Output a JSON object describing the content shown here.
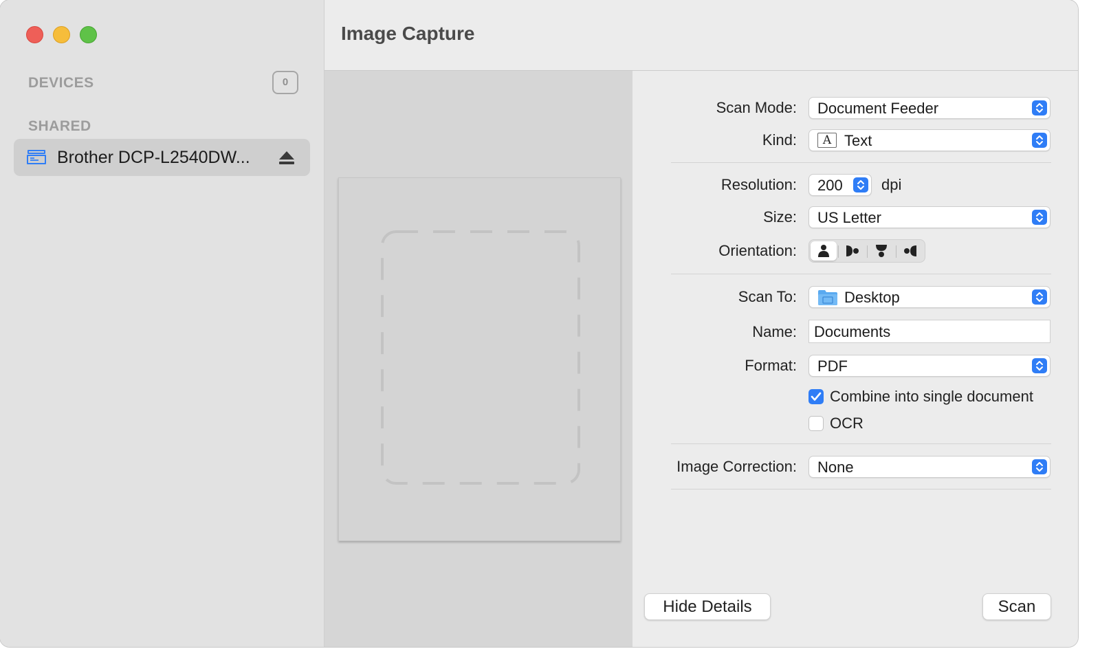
{
  "window": {
    "title": "Image Capture"
  },
  "sidebar": {
    "devices_label": "DEVICES",
    "devices_count": "0",
    "shared_label": "SHARED",
    "shared_items": [
      {
        "label": "Brother DCP-L2540DW...",
        "icon": "scanner-icon",
        "action_icon": "eject-icon"
      }
    ]
  },
  "scan_settings": {
    "scan_mode": {
      "label": "Scan Mode:",
      "value": "Document Feeder"
    },
    "kind": {
      "label": "Kind:",
      "value": "Text",
      "icon": "text-kind-icon",
      "icon_glyph": "A"
    },
    "resolution": {
      "label": "Resolution:",
      "value": "200",
      "unit": "dpi"
    },
    "size": {
      "label": "Size:",
      "value": "US Letter"
    },
    "orientation": {
      "label": "Orientation:",
      "options": [
        "portrait",
        "rotate-right",
        "upside-down",
        "rotate-left"
      ],
      "selected": "portrait"
    },
    "scan_to": {
      "label": "Scan To:",
      "value": "Desktop",
      "icon": "folder-icon"
    },
    "name": {
      "label": "Name:",
      "value": "Documents"
    },
    "format": {
      "label": "Format:",
      "value": "PDF"
    },
    "combine": {
      "label": "Combine into single document",
      "checked": true
    },
    "ocr": {
      "label": "OCR",
      "checked": false
    },
    "image_correction": {
      "label": "Image Correction:",
      "value": "None"
    }
  },
  "buttons": {
    "hide_details": "Hide Details",
    "scan": "Scan"
  },
  "colors": {
    "accent": "#2f7df6",
    "close": "#ee5f58",
    "minimize": "#f6bd3b",
    "maximize": "#5fc248"
  }
}
